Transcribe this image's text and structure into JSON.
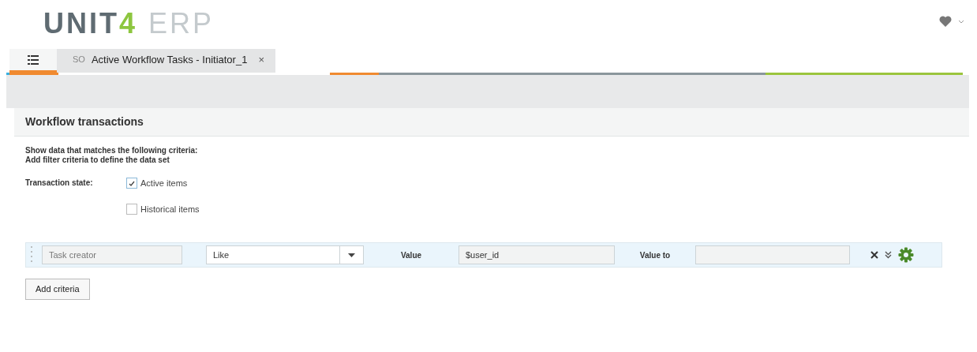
{
  "logo": {
    "brand": "UNIT",
    "mark": "4",
    "product": "ERP"
  },
  "tabs": [
    {
      "kind": "menu",
      "selected": false
    },
    {
      "kind": "document",
      "prefix": "SO",
      "label": "Active Workflow Tasks - Initiator_1",
      "close": "×",
      "selected": true
    }
  ],
  "panel": {
    "title": "Workflow transactions",
    "intro": [
      "Show data that matches the following criteria:",
      "Add filter criteria to define the data set"
    ],
    "state_label": "Transaction state:",
    "states": [
      {
        "label": "Active items",
        "checked": true
      },
      {
        "label": "Historical items",
        "checked": false
      }
    ],
    "criteria": [
      {
        "field": "Task creator",
        "operator": "Like",
        "value_label": "Value",
        "value": "$user_id",
        "value_to_label": "Value to"
      }
    ],
    "add_button": "Add criteria"
  }
}
